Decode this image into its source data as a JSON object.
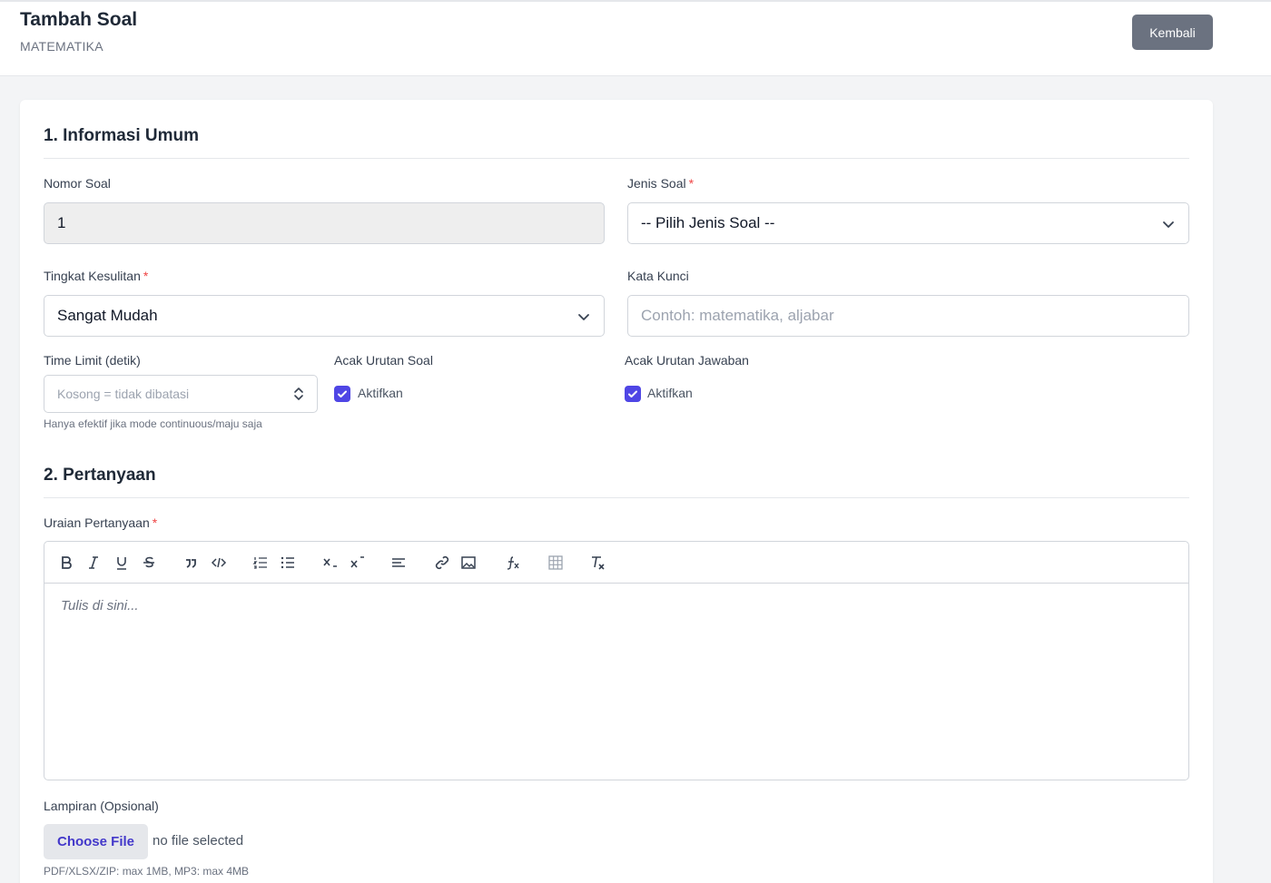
{
  "header": {
    "title": "Tambah Soal",
    "subtitle": "MATEMATIKA",
    "back_label": "Kembali"
  },
  "section1": {
    "title": "1. Informasi Umum",
    "nomor_soal": {
      "label": "Nomor Soal",
      "value": "1"
    },
    "jenis_soal": {
      "label": "Jenis Soal",
      "required": "*",
      "value": "-- Pilih Jenis Soal --"
    },
    "tingkat_kesulitan": {
      "label": "Tingkat Kesulitan",
      "required": "*",
      "value": "Sangat Mudah"
    },
    "kata_kunci": {
      "label": "Kata Kunci",
      "placeholder": "Contoh: matematika, aljabar"
    },
    "time_limit": {
      "label": "Time Limit (detik)",
      "placeholder": "Kosong = tidak dibatasi",
      "hint": "Hanya efektif jika mode continuous/maju saja"
    },
    "acak_soal": {
      "label": "Acak Urutan Soal",
      "checkbox_label": "Aktifkan",
      "checked": true
    },
    "acak_jawaban": {
      "label": "Acak Urutan Jawaban",
      "checkbox_label": "Aktifkan",
      "checked": true
    }
  },
  "section2": {
    "title": "2. Pertanyaan",
    "uraian": {
      "label": "Uraian Pertanyaan",
      "required": "*",
      "placeholder": "Tulis di sini..."
    },
    "toolbar_icons": [
      "bold-icon",
      "italic-icon",
      "underline-icon",
      "strikethrough-icon",
      "blockquote-icon",
      "code-block-icon",
      "ordered-list-icon",
      "bullet-list-icon",
      "subscript-icon",
      "superscript-icon",
      "align-icon",
      "link-icon",
      "image-icon",
      "formula-icon",
      "table-icon",
      "clear-format-icon"
    ],
    "lampiran": {
      "label": "Lampiran (Opsional)",
      "button": "Choose File",
      "status": "no file selected",
      "hint": "PDF/XLSX/ZIP: max 1MB, MP3: max 4MB"
    }
  },
  "colors": {
    "accent": "#4f46e5",
    "required": "#ef4444",
    "back_button": "#6b7280"
  }
}
